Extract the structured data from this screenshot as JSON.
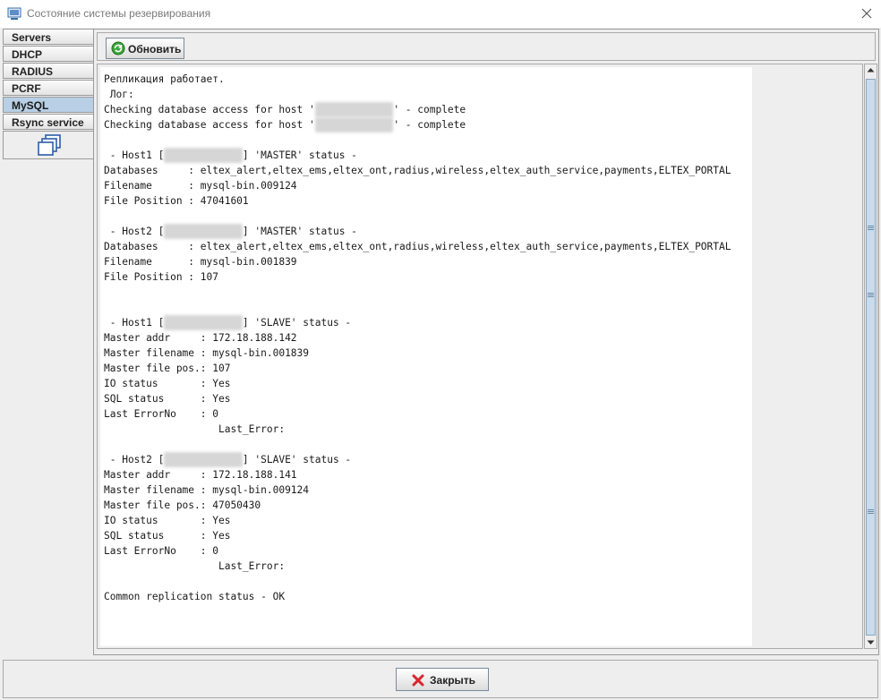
{
  "window": {
    "title": "Состояние системы резервирования"
  },
  "tabs": [
    {
      "label": "Servers"
    },
    {
      "label": "DHCP"
    },
    {
      "label": "RADIUS"
    },
    {
      "label": "PCRF"
    },
    {
      "label": "MySQL",
      "active": true
    },
    {
      "label": "Rsync service"
    }
  ],
  "toolbar": {
    "refresh_label": "Обновить"
  },
  "log": {
    "l1": "Репликация работает.",
    "l2": " Лог:",
    "l3a": "Checking database access for host '",
    "l3b": "' - complete",
    "l4a": "Checking database access for host '",
    "l4b": "' - complete",
    "m1_head_a": " - Host1 [",
    "m1_head_b": "] 'MASTER' status -",
    "m1_db": "Databases     : eltex_alert,eltex_ems,eltex_ont,radius,wireless,eltex_auth_service,payments,ELTEX_PORTAL",
    "m1_file": "Filename      : mysql-bin.009124",
    "m1_pos": "File Position : 47041601",
    "m2_head_a": " - Host2 [",
    "m2_head_b": "] 'MASTER' status -",
    "m2_db": "Databases     : eltex_alert,eltex_ems,eltex_ont,radius,wireless,eltex_auth_service,payments,ELTEX_PORTAL",
    "m2_file": "Filename      : mysql-bin.001839",
    "m2_pos": "File Position : 107",
    "s1_head_a": " - Host1 [",
    "s1_head_b": "] 'SLAVE' status -",
    "s1_addr": "Master addr     : 172.18.188.142",
    "s1_file": "Master filename : mysql-bin.001839",
    "s1_pos": "Master file pos.: 107",
    "s1_io": "IO status       : Yes",
    "s1_sql": "SQL status      : Yes",
    "s1_errno": "Last ErrorNo    : 0",
    "s1_err": "                   Last_Error:",
    "s2_head_a": " - Host2 [",
    "s2_head_b": "] 'SLAVE' status -",
    "s2_addr": "Master addr     : 172.18.188.141",
    "s2_file": "Master filename : mysql-bin.009124",
    "s2_pos": "Master file pos.: 47050430",
    "s2_io": "IO status       : Yes",
    "s2_sql": "SQL status      : Yes",
    "s2_errno": "Last ErrorNo    : 0",
    "s2_err": "                   Last_Error:",
    "common": "Common replication status - OK"
  },
  "footer": {
    "close_label": "Закрыть"
  },
  "colors": {
    "active_tab": "#b8cfe5",
    "scroll_thumb": "#c8dcee",
    "close_red": "#d9262c",
    "refresh_green": "#3aa63a"
  }
}
